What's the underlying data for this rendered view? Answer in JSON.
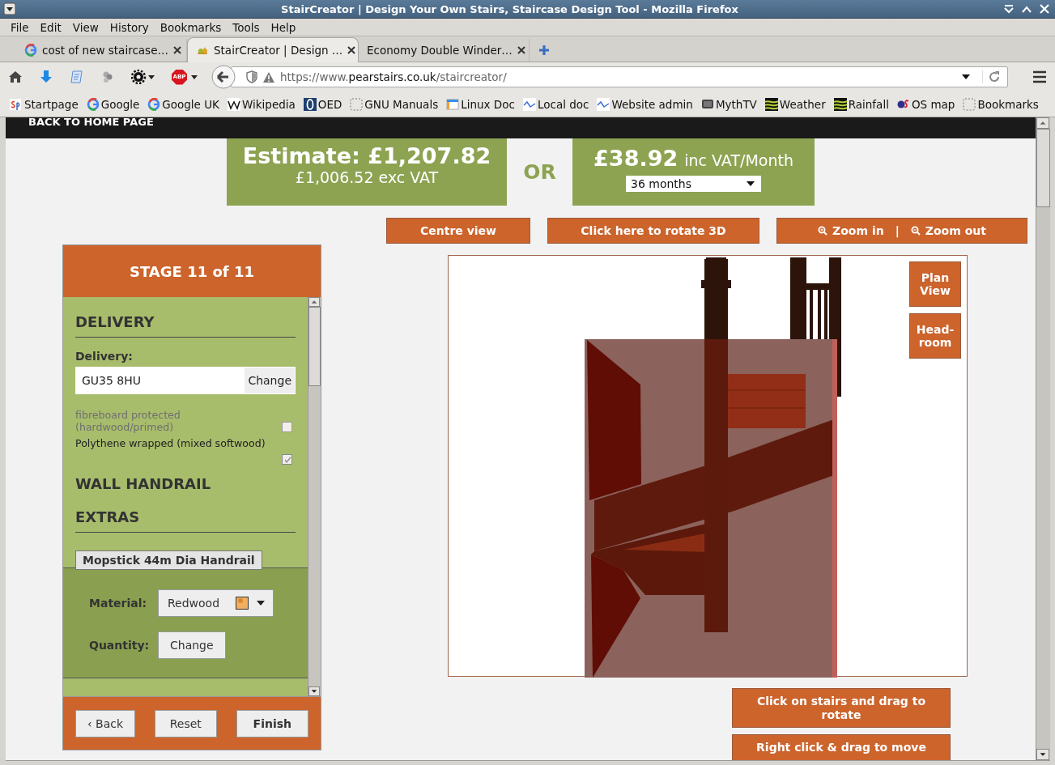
{
  "window": {
    "title": "StairCreator | Design Your Own Stairs, Staircase Design Tool - Mozilla Firefox"
  },
  "menu": [
    "File",
    "Edit",
    "View",
    "History",
    "Bookmarks",
    "Tools",
    "Help"
  ],
  "tabs": [
    {
      "label": "cost of new staircase…",
      "kind": "google",
      "selected": false
    },
    {
      "label": "StairCreator | Design …",
      "kind": "site",
      "selected": true
    },
    {
      "label": "Economy Double Winder…",
      "kind": "none",
      "selected": false
    }
  ],
  "toolbar": {
    "adblock_badge": "ABP"
  },
  "address": {
    "prefix": "https://www.",
    "domain": "pearstairs.co.uk",
    "path": "/staircreator/"
  },
  "bookmarks": [
    {
      "label": "Startpage",
      "kind": "startpage"
    },
    {
      "label": "Google",
      "kind": "google"
    },
    {
      "label": "Google UK",
      "kind": "google"
    },
    {
      "label": "Wikipedia",
      "kind": "wiki"
    },
    {
      "label": "OED",
      "kind": "oed"
    },
    {
      "label": "GNU Manuals",
      "kind": "blank"
    },
    {
      "label": "Linux Doc",
      "kind": "doc"
    },
    {
      "label": "Local doc",
      "kind": "wave"
    },
    {
      "label": "Website admin",
      "kind": "wave"
    },
    {
      "label": "MythTV",
      "kind": "tv"
    },
    {
      "label": "Weather",
      "kind": "metoffice"
    },
    {
      "label": "Rainfall",
      "kind": "metoffice"
    },
    {
      "label": "OS map",
      "kind": "os"
    },
    {
      "label": "Bookmarks",
      "kind": "blank"
    }
  ],
  "page": {
    "back_link": "BACK TO HOME PAGE",
    "estimate": {
      "label": "Estimate: £1,207.82",
      "exc_vat": "£1,006.52 exc VAT"
    },
    "or": "OR",
    "monthly": {
      "amount": "£38.92",
      "suffix": "inc VAT/Month",
      "term": "36 months"
    },
    "view_buttons": [
      {
        "label": "Centre view"
      },
      {
        "label": "Click here to rotate 3D"
      }
    ],
    "zoom": {
      "in": "Zoom in",
      "separator": "|",
      "out": "Zoom out"
    },
    "viewer_buttons": [
      {
        "label": "Plan View"
      },
      {
        "label": "Head-room"
      }
    ],
    "hints": [
      "Click on stairs and drag to rotate",
      "Right click & drag to move"
    ]
  },
  "panel": {
    "title": "STAGE 11 of 11",
    "delivery": {
      "heading": "DELIVERY",
      "label": "Delivery:",
      "value": "GU35 8HU",
      "button": "Change",
      "options": [
        {
          "label": "fibreboard protected (hardwood/primed)",
          "checked": false,
          "disabled": true
        },
        {
          "label": "Polythene wrapped (mixed softwood)",
          "checked": true,
          "disabled": false
        }
      ]
    },
    "wall_handrail": {
      "heading": "WALL HANDRAIL"
    },
    "extras": {
      "heading": "EXTRAS",
      "items": [
        {
          "title": "Mopstick 44m Dia Handrail",
          "material_label": "Material:",
          "material": "Redwood",
          "quantity_label": "Quantity:",
          "quantity_button": "Change"
        }
      ]
    },
    "footer_buttons": [
      {
        "label": "‹ Back",
        "kind": "normal"
      },
      {
        "label": "Reset",
        "kind": "normal"
      },
      {
        "label": "Finish",
        "kind": "primary"
      }
    ]
  }
}
